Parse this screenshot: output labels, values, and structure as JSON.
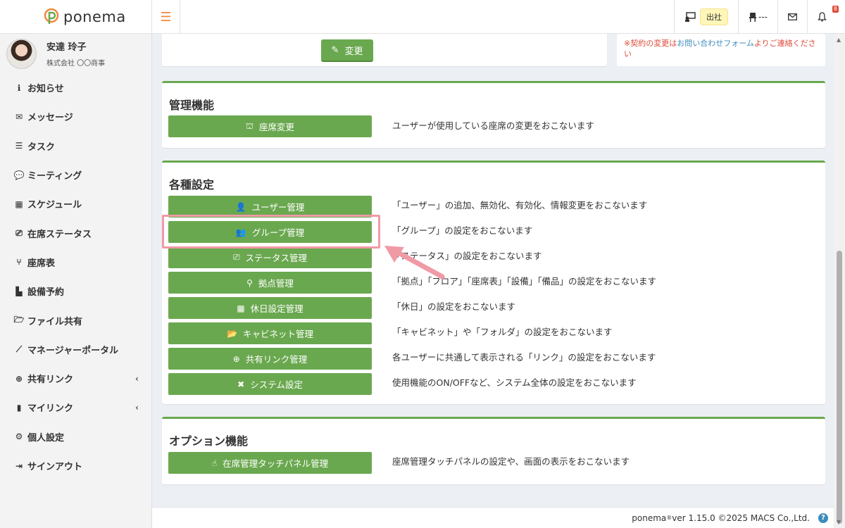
{
  "app": {
    "name": "ponema"
  },
  "header": {
    "attendance_label": "出社",
    "seat_value": "---"
  },
  "user": {
    "name": "安達 玲子",
    "company": "株式会社 〇〇商事"
  },
  "sidebar": {
    "items": [
      {
        "label": "お知らせ",
        "icon": "info-circle-icon"
      },
      {
        "label": "メッセージ",
        "icon": "envelope-icon"
      },
      {
        "label": "タスク",
        "icon": "checklist-icon"
      },
      {
        "label": "ミーティング",
        "icon": "comments-icon"
      },
      {
        "label": "スケジュール",
        "icon": "calendar-icon"
      },
      {
        "label": "在席ステータス",
        "icon": "status-icon"
      },
      {
        "label": "座席表",
        "icon": "chair-icon"
      },
      {
        "label": "設備予約",
        "icon": "equipment-icon"
      },
      {
        "label": "ファイル共有",
        "icon": "folder-icon"
      },
      {
        "label": "マネージャーポータル",
        "icon": "chart-icon"
      },
      {
        "label": "共有リンク",
        "icon": "globe-icon"
      },
      {
        "label": "マイリンク",
        "icon": "bookmark-icon"
      },
      {
        "label": "個人設定",
        "icon": "gear-icon"
      },
      {
        "label": "サインアウト",
        "icon": "sign-out-icon"
      }
    ]
  },
  "top_section": {
    "change_button": "変更",
    "notice_red1": "※契約の変更は",
    "notice_link": "お問い合わせフォーム",
    "notice_red2": "よりご連絡くださ",
    "notice_red3": "い"
  },
  "admin_section": {
    "title": "管理機能",
    "rows": [
      {
        "button": "座席変更",
        "desc": "ユーザーが使用している座席の変更をおこないます"
      }
    ]
  },
  "settings_section": {
    "title": "各種設定",
    "rows": [
      {
        "button": "ユーザー管理",
        "desc": "「ユーザー」の追加、無効化、有効化、情報変更をおこないます"
      },
      {
        "button": "グループ管理",
        "desc": "「グループ」の設定をおこないます"
      },
      {
        "button": "ステータス管理",
        "desc": "「ステータス」の設定をおこないます"
      },
      {
        "button": "拠点管理",
        "desc": "「拠点」「フロア」「座席表」「設備」「備品」の設定をおこないます"
      },
      {
        "button": "休日設定管理",
        "desc": "「休日」の設定をおこないます"
      },
      {
        "button": "キャビネット管理",
        "desc": "「キャビネット」や「フォルダ」の設定をおこないます"
      },
      {
        "button": "共有リンク管理",
        "desc": "各ユーザーに共通して表示される「リンク」の設定をおこないます"
      },
      {
        "button": "システム設定",
        "desc": "使用機能のON/OFFなど、システム全体の設定をおこないます"
      }
    ]
  },
  "option_section": {
    "title": "オプション機能",
    "rows": [
      {
        "button": "在席管理タッチパネル管理",
        "desc": "座席管理タッチパネルの設定や、画面の表示をおこないます"
      }
    ]
  },
  "footer": {
    "brand": "ponema",
    "reg": "®",
    "version": " ver 1.15.0 ©2025 MACS Co.,Ltd."
  },
  "colors": {
    "accent_green": "#6aa84f",
    "highlight_pink": "#f09aa6",
    "logo_orange": "#f0883a"
  }
}
